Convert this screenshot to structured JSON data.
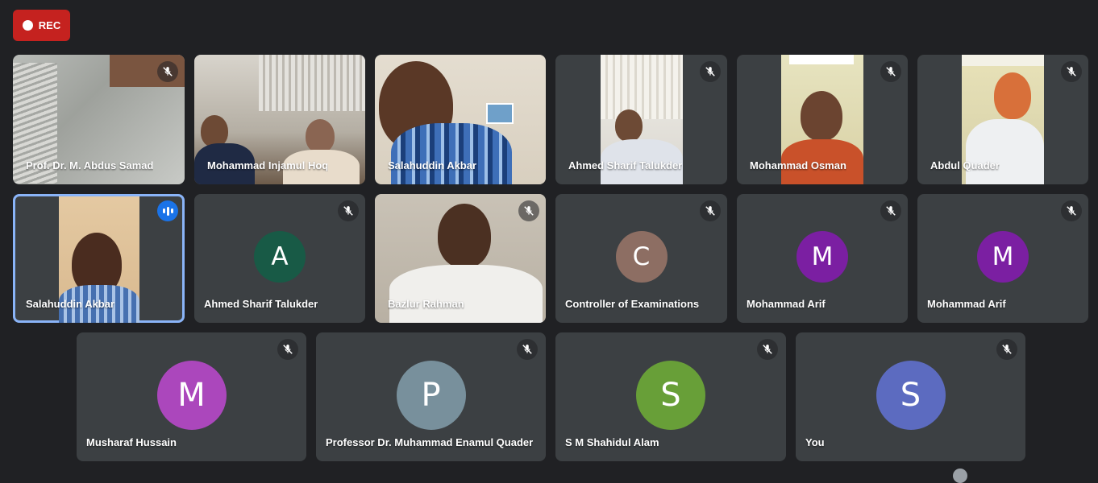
{
  "recording": {
    "label": "REC",
    "color": "#c5221f"
  },
  "participants": [
    {
      "name": "Prof. Dr. M. Abdus Samad",
      "muted": true,
      "video": true
    },
    {
      "name": "Mohammad Injamul Hoq",
      "muted": false,
      "video": true
    },
    {
      "name": "Salahuddin Akbar",
      "muted": false,
      "video": true
    },
    {
      "name": "Ahmed Sharif Talukder",
      "muted": true,
      "video": true
    },
    {
      "name": "Mohammad Osman",
      "muted": true,
      "video": true
    },
    {
      "name": "Abdul Quader",
      "muted": true,
      "video": true
    },
    {
      "name": "Salahuddin Akbar",
      "muted": false,
      "speaking": true,
      "video": true,
      "active": true
    },
    {
      "name": "Ahmed Sharif Talukder",
      "muted": true,
      "video": false,
      "initial": "A",
      "avatar_color": "#185a46"
    },
    {
      "name": "Bazlur Rahman",
      "muted": true,
      "video": true
    },
    {
      "name": "Controller of Examinations",
      "muted": true,
      "video": false,
      "initial": "C",
      "avatar_color": "#8d6e63"
    },
    {
      "name": "Mohammad Arif",
      "muted": true,
      "video": false,
      "initial": "M",
      "avatar_color": "#7b1fa2"
    },
    {
      "name": "Mohammad Arif",
      "muted": true,
      "video": false,
      "initial": "M",
      "avatar_color": "#7b1fa2"
    },
    {
      "name": "Musharaf Hussain",
      "muted": true,
      "video": false,
      "initial": "M",
      "avatar_color": "#ab47bc"
    },
    {
      "name": "Professor Dr. Muhammad Enamul Quader",
      "muted": true,
      "video": false,
      "initial": "P",
      "avatar_color": "#78909c"
    },
    {
      "name": "S M Shahidul Alam",
      "muted": true,
      "video": false,
      "initial": "S",
      "avatar_color": "#689f38"
    },
    {
      "name": "You",
      "muted": true,
      "video": false,
      "initial": "S",
      "avatar_color": "#5c6bc0"
    }
  ],
  "icons": {
    "muted": "mic-off-icon",
    "speaking": "audio-level-icon",
    "record": "record-dot-icon"
  }
}
